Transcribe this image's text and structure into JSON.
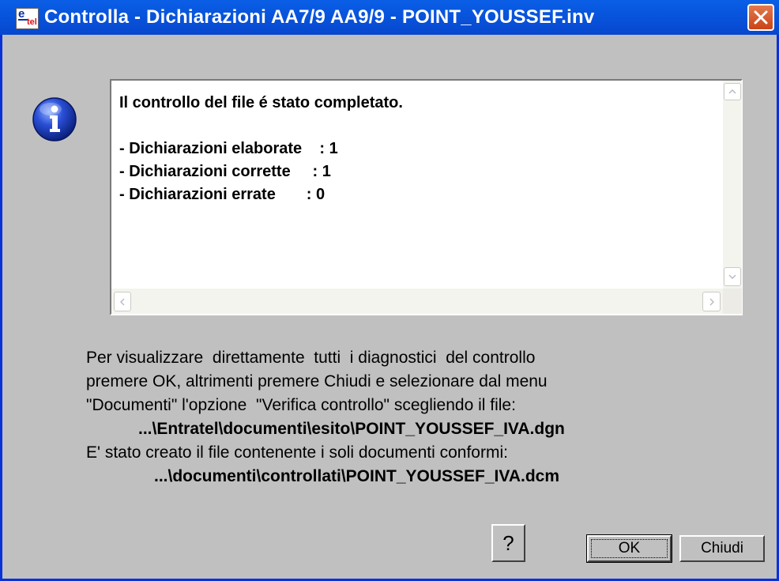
{
  "window": {
    "title": "Controlla - Dichiarazioni AA7/9 AA9/9 - POINT_YOUSSEF.inv",
    "app_icon": "entratel-app-icon",
    "title_bar_color": "#0855dd",
    "close_icon": "close-icon",
    "close_color": "#d5542a"
  },
  "result_box": {
    "lines": [
      "Il controllo del file é stato completato.",
      "",
      "- Dichiarazioni elaborate    : 1",
      "- Dichiarazioni corrette     : 1",
      "- Dichiarazioni errate       : 0"
    ]
  },
  "info_icon": "info-icon",
  "message": {
    "line1": "Per visualizzare  direttamente  tutti  i diagnostici  del controllo",
    "line2": "premere OK, altrimenti premere Chiudi e selezionare dal menu",
    "line3": "\"Documenti\" l'opzione  \"Verifica controllo\" scegliendo il file:",
    "path1": "...\\Entratel\\documenti\\esito\\POINT_YOUSSEF_IVA.dgn",
    "line4": "E' stato creato il file contenente i soli documenti conformi:",
    "path2": "...\\documenti\\controllati\\POINT_YOUSSEF_IVA.dcm"
  },
  "buttons": {
    "help": "?",
    "ok": "OK",
    "close": "Chiudi"
  }
}
